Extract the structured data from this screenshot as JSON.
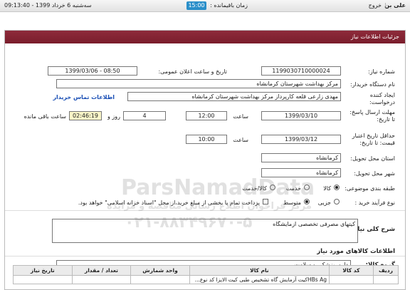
{
  "topbar": {
    "user": "علی بن",
    "exit": "خروج",
    "remaining_label": "زمان باقیمانده :",
    "clock": "15:00",
    "datetime": "سه‌شنبه 6 خرداد 1399 - 09:13:40"
  },
  "panel": {
    "title": "جزئیات اطلاعات نیاز"
  },
  "form": {
    "need_number_label": "شماره نیاز:",
    "need_number": "1199030710000024",
    "announce_label": "تاریخ و ساعت اعلان عمومی:",
    "announce_value": "1399/03/06 - 08:50",
    "buyer_label": "نام دستگاه خریدار:",
    "buyer": "مرکز بهداشت شهرستان کرمانشاه",
    "creator_label": "ایجاد کننده درخواست:",
    "creator": "مهدی  زارعی قلعه کارپرداز مرکز بهداشت شهرستان کرمانشاه",
    "contact_link": "اطلاعات تماس خریدار",
    "deadline_label": "مهلت ارسال پاسخ: تا تاریخ:",
    "deadline_date": "1399/03/10",
    "time_label": "ساعت",
    "deadline_time": "12:00",
    "days_value": "4",
    "days_label": "روز و",
    "countdown": "02:46:19",
    "remaining_label": "ساعت باقی مانده",
    "validity_label": "حداقل تاریخ اعتبار قیمت: تا تاریخ:",
    "validity_date": "1399/03/12",
    "validity_time_label": "ساعت",
    "validity_time": "10:00",
    "province_label": "استان محل تحویل:",
    "province": "کرمانشاه",
    "city_label": "شهر محل تحویل:",
    "city": "کرمانشاه",
    "category_label": "طبقه بندی موضوعی:",
    "category_options": [
      "کالا",
      "خدمت",
      "کالا/خدمت"
    ],
    "process_label": "نوع فرآیند خرید :",
    "process_options": [
      "جزیی",
      "متوسط"
    ],
    "payment_note": "پرداخت تمام یا بخشی از مبلغ خرید،از محل \"اسناد خزانه اسلامی\" خواهد بود."
  },
  "summary": {
    "label": "شرح کلی نیاز:",
    "value": "کیتهای مصرفی تخصصی ازمایشگاه"
  },
  "goods": {
    "section_title": "اطلاعات کالاهای مورد نیاز",
    "group_label": "گروه کالا:",
    "group_value": "دارو، پزشکی و سلامت",
    "columns": [
      "ردیف",
      "کد کالا",
      "نام کالا",
      "واحد شمارش",
      "تعداد / مقدار",
      "تاریخ نیاز"
    ],
    "row_partial": "HBs Agکیت آزمایش گاه تشخیص طبی کیت الایزا کد نوع..."
  },
  "watermark": {
    "line1": "ParsNamadData",
    "line2": "مرکز فراخوان اطلاع رسانی مناقصه و مزایده",
    "line3": "۰۲۱-۸۸۳۴۹۶۷۰-۵"
  },
  "colors": {
    "header": "#7a1d2c",
    "link": "#1a4fb5",
    "clock": "#2a8fc9",
    "countdown_bg": "#f9f5c8"
  }
}
